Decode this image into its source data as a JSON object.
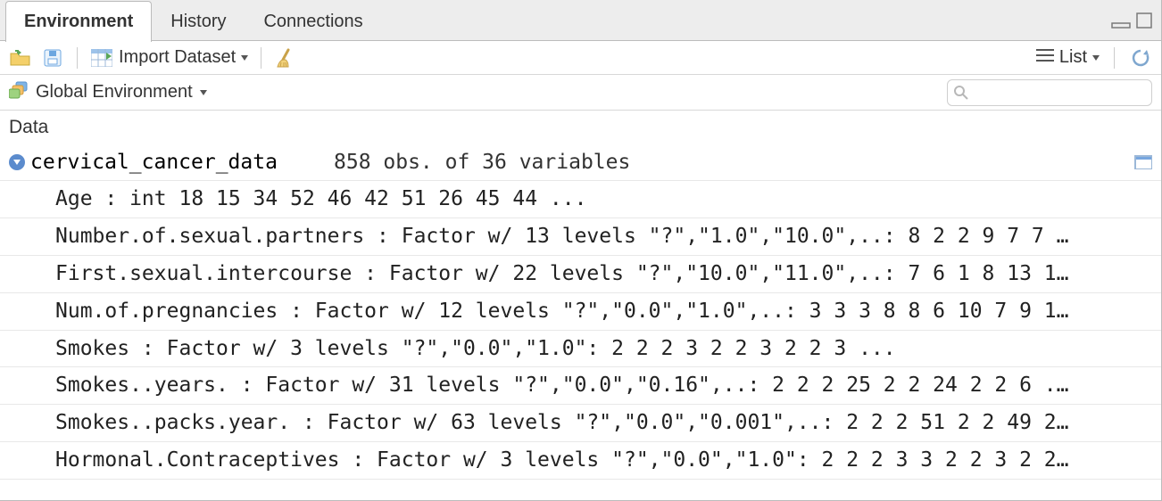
{
  "tabs": {
    "environment": "Environment",
    "history": "History",
    "connections": "Connections"
  },
  "toolbar": {
    "import_label": "Import Dataset",
    "list_mode_label": "List"
  },
  "scope": {
    "label": "Global Environment"
  },
  "search": {
    "placeholder": ""
  },
  "section_header": "Data",
  "object": {
    "name": "cervical_cancer_data",
    "desc": "858 obs. of 36 variables"
  },
  "variables": [
    "Age : int  18 15 34 52 46 42 51 26 45 44 ...",
    "Number.of.sexual.partners : Factor w/ 13 levels \"?\",\"1.0\",\"10.0\",..: 8 2 2 9 7 7 …",
    "First.sexual.intercourse : Factor w/ 22 levels \"?\",\"10.0\",\"11.0\",..: 7 6 1 8 13 1…",
    "Num.of.pregnancies : Factor w/ 12 levels \"?\",\"0.0\",\"1.0\",..: 3 3 3 8 8 6 10 7 9 1…",
    "Smokes : Factor w/ 3 levels \"?\",\"0.0\",\"1.0\": 2 2 2 3 2 2 3 2 2 3 ...",
    "Smokes..years. : Factor w/ 31 levels \"?\",\"0.0\",\"0.16\",..: 2 2 2 25 2 2 24 2 2 6 .…",
    "Smokes..packs.year. : Factor w/ 63 levels \"?\",\"0.0\",\"0.001\",..: 2 2 2 51 2 2 49 2…",
    "Hormonal.Contraceptives : Factor w/ 3 levels \"?\",\"0.0\",\"1.0\": 2 2 2 3 3 2 2 3 2 2…"
  ]
}
